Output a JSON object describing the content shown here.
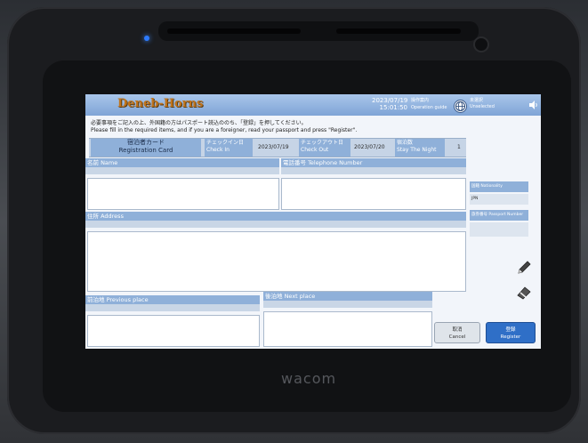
{
  "device": {
    "brand": "wacom"
  },
  "header": {
    "logo": "Deneb-Horns",
    "date": "2023/07/19",
    "time": "15:01:50",
    "guide_jp": "操作案内",
    "guide_en": "Operation guide",
    "lang_jp": "未選択",
    "lang_en": "Unselected",
    "icons": {
      "globe": "globe-icon",
      "speaker": "speaker-icon"
    }
  },
  "notice": {
    "jp": "必要事項をご記入の上、外国籍の方はパスポート読込ののち、「登録」を押してください。",
    "en": "Please fill in the required items, and if you are a foreigner, read your passport and press \"Register\"."
  },
  "info_bar": {
    "card_jp": "宿泊者カード",
    "card_en": "Registration Card",
    "checkin_jp": "チェックイン日",
    "checkin_en": "Check In",
    "checkin_value": "2023/07/19",
    "checkout_jp": "チェックアウト日",
    "checkout_en": "Check Out",
    "checkout_value": "2023/07/20",
    "nights_jp": "宿泊数",
    "nights_en": "Stay The Night",
    "nights_value": "1"
  },
  "form": {
    "name_label": "名前 Name",
    "phone_label": "電話番号 Telephone Number",
    "address_label": "住所 Address",
    "previous_label": "前泊地 Previous place",
    "next_label": "後泊地 Next place",
    "nationality_label": "国籍 Nationality",
    "nationality_value": "JPN",
    "passport_label": "旅券番号 Passport Number"
  },
  "tools": {
    "pen": "pen-icon",
    "eraser": "eraser-icon"
  },
  "buttons": {
    "cancel_jp": "取消",
    "cancel_en": "Cancel",
    "register_jp": "登録",
    "register_en": "Register"
  },
  "colors": {
    "header": "#8fb0d9",
    "logo": "#c0741c",
    "register": "#2f6fc7",
    "background": "#f2f5fa"
  }
}
